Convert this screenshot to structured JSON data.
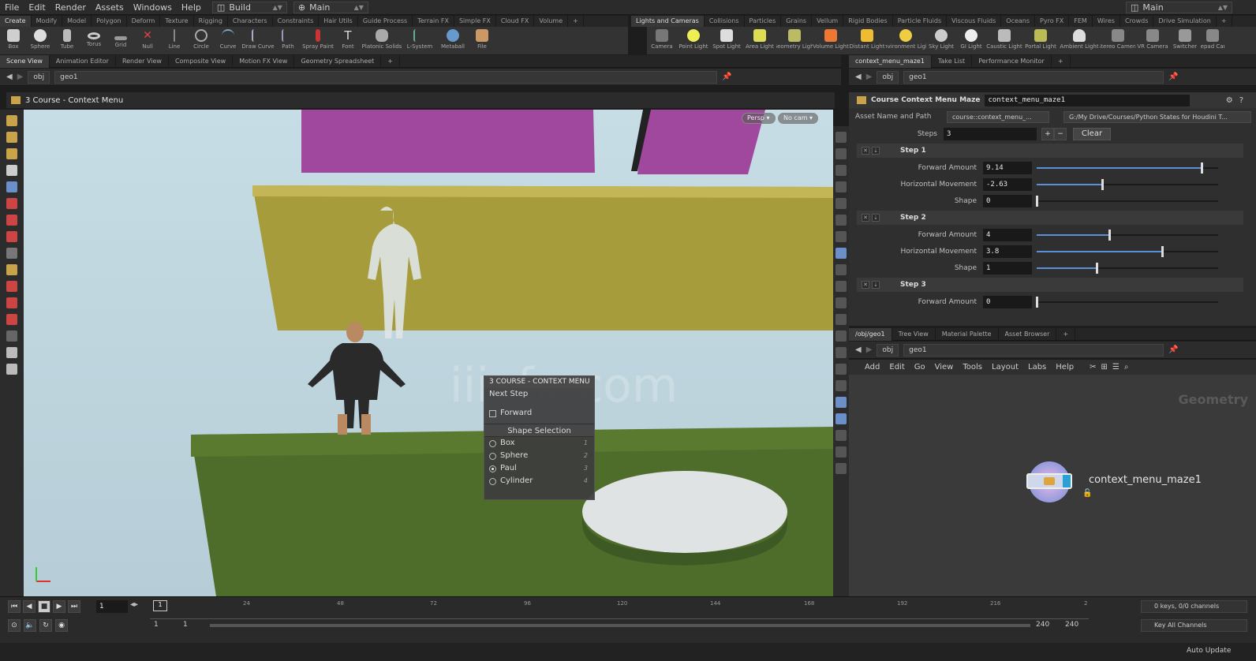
{
  "menubar": {
    "items": [
      "File",
      "Edit",
      "Render",
      "Assets",
      "Windows",
      "Help"
    ],
    "desktop": "Build",
    "network_context": "Main",
    "right_desktop": "Main"
  },
  "shelf_tabs_left": [
    "Create",
    "Modify",
    "Model",
    "Polygon",
    "Deform",
    "Texture",
    "Rigging",
    "Characters",
    "Constraints",
    "Hair Utils",
    "Guide Process",
    "Terrain FX",
    "Simple FX",
    "Cloud FX",
    "Volume"
  ],
  "shelf_tabs_right": [
    "Lights and Cameras",
    "Collisions",
    "Particles",
    "Grains",
    "Vellum",
    "Rigid Bodies",
    "Particle Fluids",
    "Viscous Fluids",
    "Oceans",
    "Pyro FX",
    "FEM",
    "Wires",
    "Crowds",
    "Drive Simulation"
  ],
  "tools_left": [
    "Box",
    "Sphere",
    "Tube",
    "Torus",
    "Grid",
    "Null",
    "Line",
    "Circle",
    "Curve",
    "Draw Curve",
    "Path",
    "Spray Paint",
    "Font",
    "Platonic Solids",
    "L-System",
    "Metaball",
    "File"
  ],
  "tools_right": [
    "Camera",
    "Point Light",
    "Spot Light",
    "Area Light",
    "Geometry Light",
    "Volume Light",
    "Distant Light",
    "Environment Light",
    "Sky Light",
    "GI Light",
    "Caustic Light",
    "Portal Light",
    "Ambient Light",
    "Stereo Camera",
    "VR Camera",
    "Switcher",
    "Gamepad Camera"
  ],
  "pane_tabs_left": [
    "Scene View",
    "Animation Editor",
    "Render View",
    "Composite View",
    "Motion FX View",
    "Geometry Spreadsheet"
  ],
  "pane_tabs_right": [
    "context_menu_maze1",
    "Take List",
    "Performance Monitor"
  ],
  "path": {
    "obj": "obj",
    "geo": "geo1"
  },
  "viewport": {
    "title": "3 Course - Context Menu",
    "persp": "Persp",
    "cam": "No cam",
    "watermark": "iiivfx.com"
  },
  "context_menu": {
    "header": "3 COURSE - CONTEXT MENU",
    "first_item": "Next Step",
    "forward": "Forward",
    "section": "Shape Selection",
    "options": [
      {
        "label": "Box",
        "key": "1"
      },
      {
        "label": "Sphere",
        "key": "2"
      },
      {
        "label": "Paul",
        "key": "3"
      },
      {
        "label": "Cylinder",
        "key": "4"
      }
    ],
    "selected_index": 2
  },
  "params": {
    "type_label": "Course Context Menu Maze",
    "node_name": "context_menu_maze1",
    "asset_label": "Asset Name and Path",
    "asset_name": "course::context_menu_...",
    "asset_path": "G:/My Drive/Courses/Python States for Houdini T...",
    "steps_label": "Steps",
    "steps_value": "3",
    "clear": "Clear",
    "steps": [
      {
        "title": "Step 1",
        "rows": [
          {
            "label": "Forward Amount",
            "value": "9.14",
            "pos": 0.91
          },
          {
            "label": "Horizontal Movement",
            "value": "-2.63",
            "pos": 0.36
          },
          {
            "label": "Shape",
            "value": "0",
            "pos": 0.0
          }
        ]
      },
      {
        "title": "Step 2",
        "rows": [
          {
            "label": "Forward Amount",
            "value": "4",
            "pos": 0.4
          },
          {
            "label": "Horizontal Movement",
            "value": "3.8",
            "pos": 0.69
          },
          {
            "label": "Shape",
            "value": "1",
            "pos": 0.33
          }
        ]
      },
      {
        "title": "Step 3",
        "rows": [
          {
            "label": "Forward Amount",
            "value": "0",
            "pos": 0.0
          }
        ]
      }
    ]
  },
  "lower_tabs": [
    "/obj/geo1",
    "Tree View",
    "Material Palette",
    "Asset Browser"
  ],
  "network_menu": [
    "Add",
    "Edit",
    "Go",
    "View",
    "Tools",
    "Layout",
    "Labs",
    "Help"
  ],
  "network": {
    "context_label": "Geometry",
    "node_label": "context_menu_maze1"
  },
  "timeline": {
    "frame": "1",
    "ticks": [
      "1",
      "24",
      "48",
      "72",
      "96",
      "120",
      "144",
      "168",
      "192",
      "216",
      "2"
    ],
    "start": "1",
    "start2": "1",
    "end": "240",
    "end2": "240",
    "keys": "0 keys, 0/0 channels",
    "key_all": "Key All Channels",
    "auto_update": "Auto Update"
  }
}
